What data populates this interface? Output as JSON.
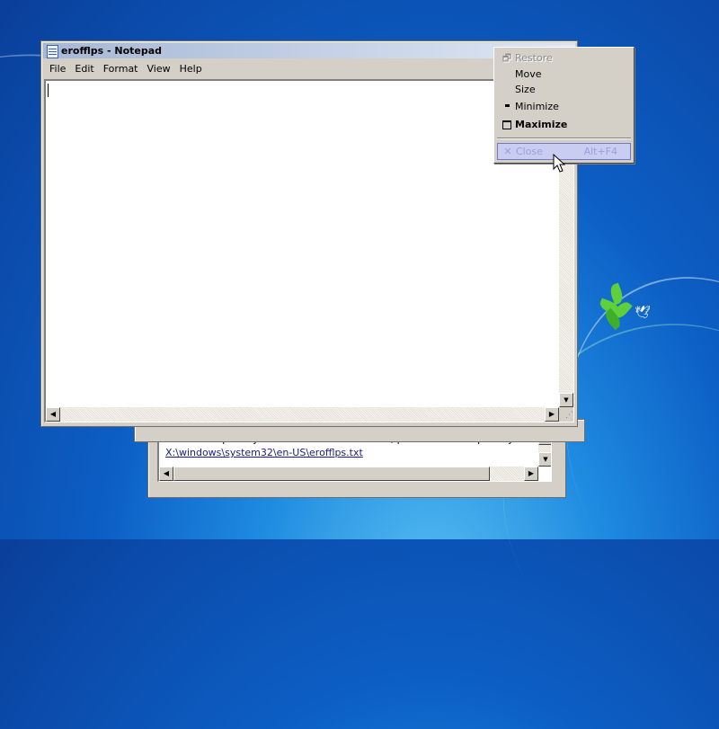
{
  "notepad": {
    "title": "erofflps - Notepad",
    "menu": [
      "File",
      "Edit",
      "Format",
      "View",
      "Help"
    ],
    "content": ""
  },
  "system_menu": {
    "items": [
      {
        "label": "Restore",
        "icon": "restore-icon",
        "enabled": false
      },
      {
        "label": "Move",
        "icon": "",
        "enabled": true
      },
      {
        "label": "Size",
        "icon": "",
        "enabled": true
      },
      {
        "label": "Minimize",
        "icon": "minimize-icon",
        "enabled": true
      },
      {
        "label": "Maximize",
        "icon": "maximize-icon",
        "enabled": true,
        "bold": true
      },
      {
        "label": "Close",
        "icon": "close-icon",
        "shortcut": "Alt+F4",
        "enabled": false,
        "highlighted": true
      }
    ]
  },
  "background_window": {
    "message": "If the online privacy statement is not available, please read our privacy statement offline:",
    "link": "X:\\windows\\system32\\en-US\\erofflps.txt"
  },
  "colors": {
    "desktop": "#0c5ec4",
    "window_face": "#d4d0c8",
    "menu_highlight": "#c9cdf1",
    "link": "#1a1a8c"
  }
}
